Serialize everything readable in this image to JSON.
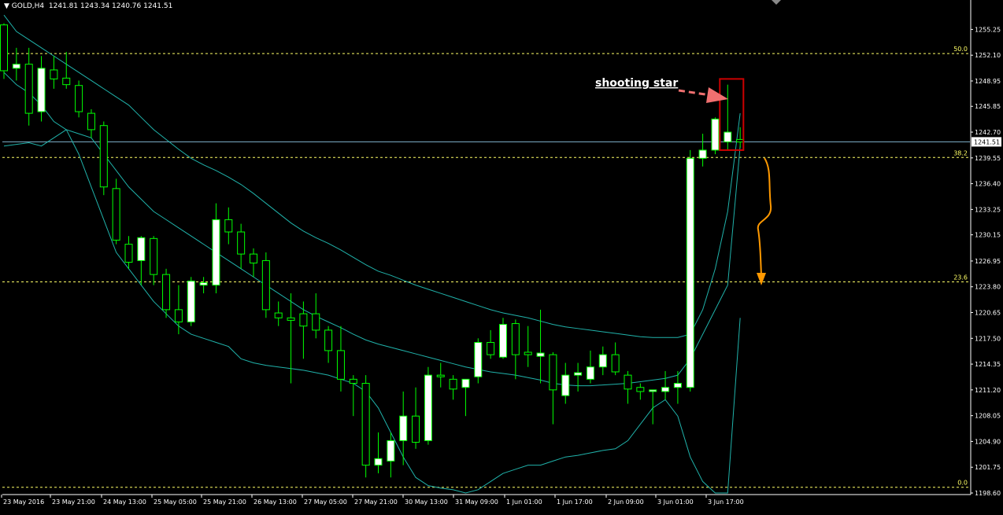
{
  "header": {
    "menu_glyph": "▼",
    "symbol": "GOLD,H4",
    "ohlc": "1241.81 1243.34 1240.76 1241.51"
  },
  "price_label": "1241.51",
  "annotation": {
    "text": "shooting star"
  },
  "colors": {
    "background": "#000000",
    "bull_body": "#ffffff",
    "bear_body": "#000000",
    "wick": "#00ff00",
    "bollinger": "#20b2aa",
    "fib_line": "#ffff66",
    "bid_line": "#7fb2cc",
    "arrow_pink": "#f07070",
    "arrow_orange": "#ff9900",
    "box_red": "#cc0000",
    "axis": "#ffffff"
  },
  "chart_data": {
    "type": "candlestick",
    "symbol": "GOLD",
    "timeframe": "H4",
    "ylim": [
      1198.6,
      1257.5
    ],
    "y_ticks": [
      "1255.25",
      "1252.10",
      "1248.95",
      "1245.85",
      "1242.70",
      "1239.55",
      "1236.40",
      "1233.25",
      "1230.15",
      "1226.95",
      "1223.80",
      "1220.65",
      "1217.50",
      "1214.35",
      "1211.20",
      "1208.05",
      "1204.90",
      "1201.75",
      "1198.60"
    ],
    "x_ticks": [
      "23 May 2016",
      "23 May 21:00",
      "24 May 13:00",
      "25 May 05:00",
      "25 May 21:00",
      "26 May 13:00",
      "27 May 05:00",
      "27 May 21:00",
      "30 May 13:00",
      "31 May 09:00",
      "1 Jun 01:00",
      "1 Jun 17:00",
      "2 Jun 09:00",
      "3 Jun 01:00",
      "3 Jun 17:00"
    ],
    "candles": [
      [
        1255.8,
        1256.0,
        1249.2,
        1250.2
      ],
      [
        1250.5,
        1253.0,
        1249.0,
        1251.0
      ],
      [
        1251.0,
        1253.0,
        1243.5,
        1245.0
      ],
      [
        1245.2,
        1252.0,
        1244.0,
        1250.5
      ],
      [
        1250.3,
        1252.0,
        1248.0,
        1249.2
      ],
      [
        1249.3,
        1252.5,
        1248.0,
        1248.5
      ],
      [
        1248.4,
        1249.0,
        1244.5,
        1245.2
      ],
      [
        1245.0,
        1245.5,
        1242.0,
        1243.0
      ],
      [
        1243.5,
        1244.0,
        1235.0,
        1236.0
      ],
      [
        1235.8,
        1237.0,
        1229.0,
        1229.5
      ],
      [
        1229.0,
        1230.0,
        1226.0,
        1226.8
      ],
      [
        1227.0,
        1230.0,
        1224.0,
        1229.8
      ],
      [
        1229.7,
        1230.0,
        1224.0,
        1225.3
      ],
      [
        1225.3,
        1226.0,
        1220.0,
        1221.0
      ],
      [
        1221.0,
        1224.0,
        1218.0,
        1219.5
      ],
      [
        1219.5,
        1225.0,
        1219.0,
        1224.5
      ],
      [
        1224.0,
        1225.0,
        1223.0,
        1224.3
      ],
      [
        1224.0,
        1234.0,
        1223.0,
        1232.0
      ],
      [
        1232.0,
        1233.5,
        1229.0,
        1230.5
      ],
      [
        1230.5,
        1231.5,
        1226.0,
        1227.8
      ],
      [
        1227.8,
        1228.5,
        1225.0,
        1226.7
      ],
      [
        1227.0,
        1228.0,
        1220.0,
        1221.0
      ],
      [
        1220.6,
        1222.0,
        1219.0,
        1220.0
      ],
      [
        1220.0,
        1223.0,
        1212.0,
        1219.7
      ],
      [
        1220.5,
        1222.0,
        1215.0,
        1219.0
      ],
      [
        1220.5,
        1223.0,
        1217.5,
        1218.5
      ],
      [
        1218.5,
        1219.0,
        1214.5,
        1216.0
      ],
      [
        1216.0,
        1219.0,
        1211.0,
        1212.5
      ],
      [
        1212.5,
        1213.0,
        1208.0,
        1212.0
      ],
      [
        1212.0,
        1213.0,
        1200.5,
        1202.0
      ],
      [
        1202.0,
        1206.0,
        1201.0,
        1202.8
      ],
      [
        1202.5,
        1206.0,
        1200.5,
        1205.0
      ],
      [
        1205.0,
        1211.0,
        1202.0,
        1208.0
      ],
      [
        1208.0,
        1211.5,
        1204.0,
        1204.8
      ],
      [
        1205.0,
        1214.0,
        1204.5,
        1213.0
      ],
      [
        1213.0,
        1214.5,
        1211.5,
        1212.8
      ],
      [
        1212.5,
        1213.0,
        1210.0,
        1211.3
      ],
      [
        1211.5,
        1212.5,
        1208.0,
        1212.5
      ],
      [
        1212.8,
        1217.5,
        1212.0,
        1217.0
      ],
      [
        1217.0,
        1218.5,
        1215.0,
        1215.5
      ],
      [
        1215.2,
        1220.0,
        1215.0,
        1219.2
      ],
      [
        1219.3,
        1219.8,
        1212.5,
        1215.5
      ],
      [
        1215.8,
        1219.0,
        1214.0,
        1215.5
      ],
      [
        1215.3,
        1221.0,
        1212.0,
        1215.7
      ],
      [
        1215.5,
        1215.8,
        1207.0,
        1211.2
      ],
      [
        1210.5,
        1214.5,
        1209.5,
        1213.0
      ],
      [
        1213.0,
        1214.5,
        1211.0,
        1213.3
      ],
      [
        1212.5,
        1216.0,
        1212.0,
        1214.0
      ],
      [
        1214.0,
        1216.5,
        1213.0,
        1215.5
      ],
      [
        1215.5,
        1217.0,
        1213.0,
        1213.4
      ],
      [
        1213.0,
        1213.5,
        1209.5,
        1211.3
      ],
      [
        1211.5,
        1212.0,
        1210.0,
        1211.0
      ],
      [
        1211.0,
        1211.2,
        1207.0,
        1211.2
      ],
      [
        1211.0,
        1213.5,
        1210.0,
        1211.5
      ],
      [
        1211.5,
        1213.5,
        1209.5,
        1212.0
      ],
      [
        1211.5,
        1240.5,
        1211.0,
        1239.5
      ],
      [
        1239.5,
        1242.5,
        1238.5,
        1240.5
      ],
      [
        1240.5,
        1244.5,
        1240.0,
        1244.3
      ],
      [
        1241.5,
        1248.5,
        1240.5,
        1242.7
      ],
      [
        1241.8,
        1243.3,
        1240.8,
        1241.5
      ]
    ],
    "bollinger": {
      "upper": [
        1257.0,
        1255.0,
        1254.0,
        1253.0,
        1252.0,
        1251.0,
        1250.0,
        1249.0,
        1248.0,
        1247.0,
        1246.0,
        1244.5,
        1243.0,
        1241.8,
        1240.6,
        1239.5,
        1238.7,
        1238.0,
        1237.2,
        1236.3,
        1235.2,
        1234.0,
        1232.8,
        1231.6,
        1230.6,
        1229.8,
        1229.1,
        1228.3,
        1227.4,
        1226.5,
        1225.7,
        1225.2,
        1224.6,
        1224.0,
        1223.5,
        1223.0,
        1222.5,
        1222.0,
        1221.5,
        1221.0,
        1220.6,
        1220.3,
        1220.0,
        1219.6,
        1219.2,
        1218.9,
        1218.7,
        1218.5,
        1218.3,
        1218.1,
        1217.9,
        1217.7,
        1217.6,
        1217.6,
        1217.6,
        1218.0,
        1221.0,
        1226.0,
        1233.0,
        1245.0
      ],
      "middle": [
        1241.0,
        1241.2,
        1241.4,
        1241.0,
        1242.0,
        1243.0,
        1242.5,
        1242.0,
        1240.0,
        1238.0,
        1236.0,
        1234.5,
        1233.0,
        1232.0,
        1231.0,
        1230.0,
        1229.0,
        1228.0,
        1227.0,
        1226.0,
        1225.0,
        1224.0,
        1223.0,
        1222.0,
        1221.0,
        1220.2,
        1219.5,
        1218.8,
        1218.0,
        1217.3,
        1216.8,
        1216.4,
        1216.0,
        1215.6,
        1215.2,
        1214.8,
        1214.4,
        1214.0,
        1213.7,
        1213.4,
        1213.2,
        1213.0,
        1212.7,
        1212.4,
        1212.0,
        1211.8,
        1211.7,
        1211.7,
        1211.8,
        1211.9,
        1212.0,
        1212.2,
        1212.4,
        1212.6,
        1213.0,
        1215.0,
        1218.0,
        1221.0,
        1224.0,
        1241.0
      ],
      "lower": [
        1250.0,
        1248.5,
        1247.5,
        1246.0,
        1244.0,
        1243.0,
        1240.0,
        1236.0,
        1232.0,
        1228.0,
        1226.0,
        1224.0,
        1222.0,
        1220.5,
        1219.0,
        1218.0,
        1217.5,
        1217.0,
        1216.5,
        1215.0,
        1214.5,
        1214.2,
        1214.0,
        1213.8,
        1213.6,
        1213.3,
        1213.0,
        1212.5,
        1212.0,
        1211.0,
        1209.0,
        1206.0,
        1203.0,
        1200.5,
        1199.5,
        1199.2,
        1199.0,
        1198.6,
        1199.0,
        1200.0,
        1201.0,
        1201.5,
        1202.0,
        1202.0,
        1202.5,
        1203.0,
        1203.2,
        1203.5,
        1203.8,
        1204.0,
        1205.0,
        1207.0,
        1209.0,
        1210.0,
        1208.0,
        1203.0,
        1200.0,
        1198.6,
        1198.6,
        1220.0
      ]
    },
    "fib_levels": [
      {
        "label": "50.0",
        "value": 1252.3
      },
      {
        "label": "38.2",
        "value": 1239.6
      },
      {
        "label": "23.6",
        "value": 1224.4
      },
      {
        "label": "0.0",
        "value": 1199.3
      }
    ],
    "bid": 1241.51
  }
}
